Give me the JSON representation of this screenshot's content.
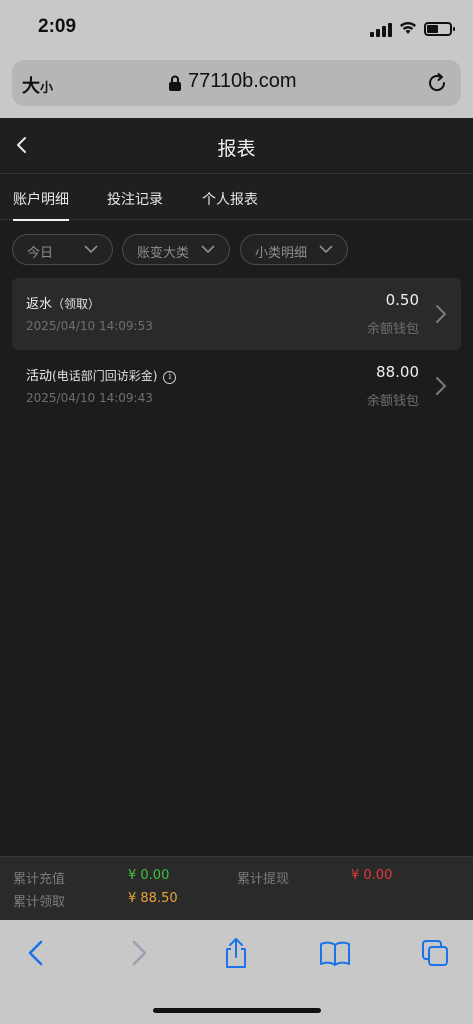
{
  "status_bar": {
    "time": "2:09"
  },
  "browser": {
    "text_size_label": "大",
    "text_size_small": "小",
    "url": "77110b.com"
  },
  "header": {
    "title": "报表"
  },
  "tabs": [
    {
      "label": "账户明细",
      "active": true
    },
    {
      "label": "投注记录",
      "active": false
    },
    {
      "label": "个人报表",
      "active": false
    }
  ],
  "filters": [
    {
      "label": "今日"
    },
    {
      "label": "账变大类"
    },
    {
      "label": "小类明细"
    }
  ],
  "records": [
    {
      "title": "返水",
      "subtitle": "（领取）",
      "time": "2025/04/10 14:09:53",
      "amount": "0.50",
      "wallet": "余额钱包"
    },
    {
      "title": "活动",
      "subtitle": "(电话部门回访彩金)",
      "time": "2025/04/10 14:09:43",
      "amount": "88.00",
      "wallet": "余额钱包"
    }
  ],
  "summary": {
    "total_deposit_label": "累计充值",
    "total_deposit_value": "¥ 0.00",
    "total_withdraw_label": "累计提现",
    "total_withdraw_value": "¥ 0.00",
    "total_claim_label": "累计领取",
    "total_claim_value": "¥ 88.50"
  },
  "colors": {
    "deposit": "#3fbf3f",
    "withdraw": "#e0393e",
    "claim": "#e8a33a",
    "safari_blue": "#1a73e8"
  },
  "icons": [
    "back-chevron-icon",
    "info-icon",
    "chevron-right-icon",
    "chevron-down-icon",
    "share-icon",
    "bookmarks-icon",
    "tabs-icon",
    "reload-icon",
    "lock-icon"
  ]
}
